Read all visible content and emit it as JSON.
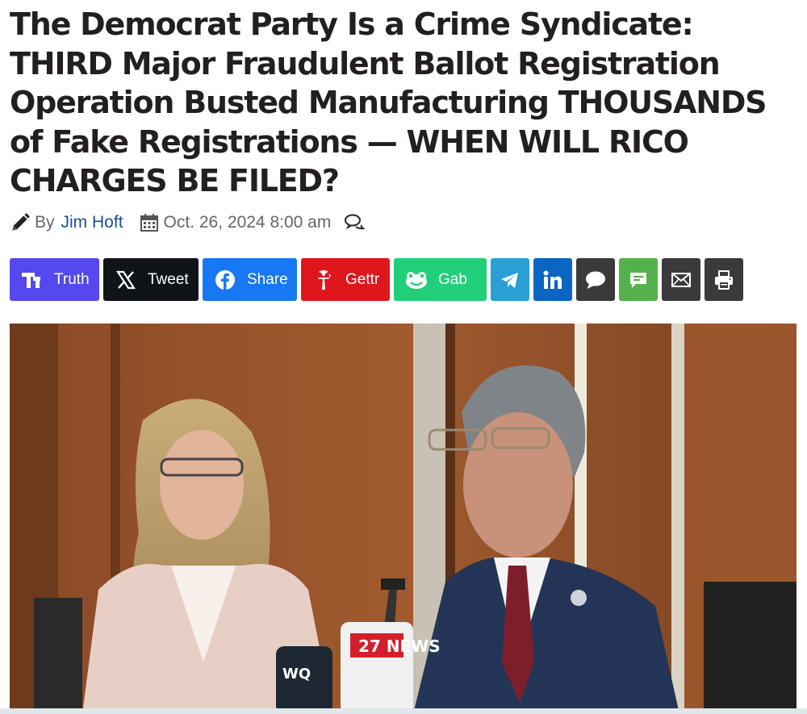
{
  "article": {
    "title": "The Democrat Party Is a Crime Syndicate: THIRD Major Fraudulent Ballot Registration Operation Busted Manufacturing THOUSANDS of Fake Registrations — WHEN WILL RICO CHARGES BE FILED?",
    "by_label": "By",
    "author": "Jim Hoft",
    "date": "Oct. 26, 2024 8:00 am"
  },
  "share": {
    "truth": "Truth",
    "tweet": "Tweet",
    "facebook": "Share",
    "gettr": "Gettr",
    "gab": "Gab"
  },
  "colors": {
    "truth": "#5448ee",
    "tweet": "#0f1419",
    "facebook": "#1877f2",
    "gettr": "#e0161d",
    "gab": "#21cf7a",
    "telegram": "#2a9fd5",
    "linkedin": "#0a66c2",
    "sms": "#3a3a3a",
    "message": "#54b04a",
    "email": "#3a3a3a",
    "print": "#3a3a3a"
  },
  "photo": {
    "mic_logos": [
      "WQ",
      "27 NEWS"
    ]
  }
}
